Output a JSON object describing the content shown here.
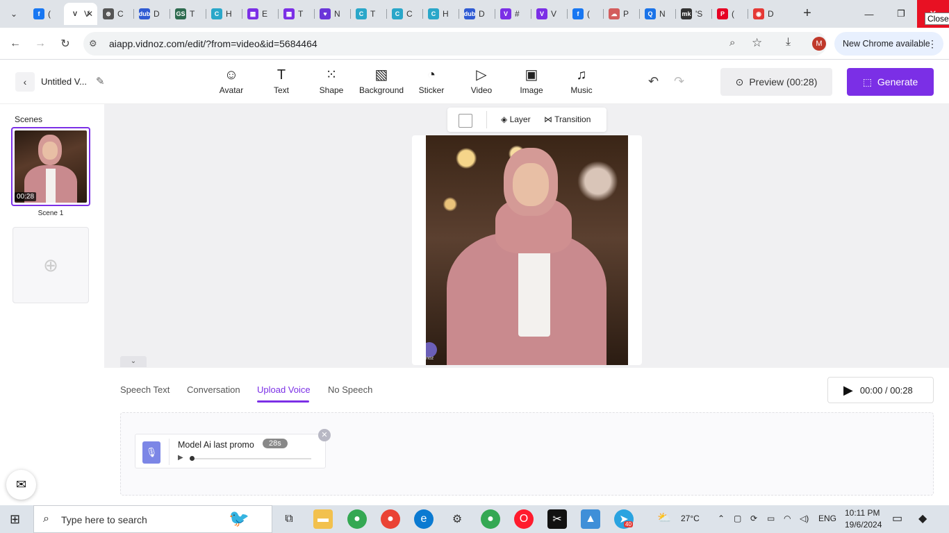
{
  "browser": {
    "tabs": [
      {
        "fav": "f",
        "color": "#1877f2",
        "title": "("
      },
      {
        "fav": "V",
        "color": "#ffffff",
        "title": "V",
        "active": true
      },
      {
        "fav": "⊛",
        "color": "#555555",
        "title": "C"
      },
      {
        "fav": "dub",
        "color": "#2f5bd3",
        "title": "D"
      },
      {
        "fav": "GS",
        "color": "#2d6b4f",
        "title": "T"
      },
      {
        "fav": "C",
        "color": "#2aa7c9",
        "title": "H"
      },
      {
        "fav": "▦",
        "color": "#7b2fe6",
        "title": "E"
      },
      {
        "fav": "▦",
        "color": "#7b2fe6",
        "title": "T"
      },
      {
        "fav": "♥",
        "color": "#6a36d9",
        "title": "N"
      },
      {
        "fav": "C",
        "color": "#2aa7c9",
        "title": "T"
      },
      {
        "fav": "C",
        "color": "#2aa7c9",
        "title": "C"
      },
      {
        "fav": "C",
        "color": "#2aa7c9",
        "title": "H"
      },
      {
        "fav": "dub",
        "color": "#2f5bd3",
        "title": "D"
      },
      {
        "fav": "V",
        "color": "#7b2fe6",
        "title": "#"
      },
      {
        "fav": "V",
        "color": "#7b2fe6",
        "title": "V"
      },
      {
        "fav": "f",
        "color": "#1877f2",
        "title": "("
      },
      {
        "fav": "☁",
        "color": "#d35d5d",
        "title": "P"
      },
      {
        "fav": "Q",
        "color": "#1a73e8",
        "title": "N"
      },
      {
        "fav": "mk",
        "color": "#333333",
        "title": "'S"
      },
      {
        "fav": "P",
        "color": "#e60023",
        "title": "("
      },
      {
        "fav": "◉",
        "color": "#e53935",
        "title": "D"
      }
    ],
    "active_tab_close": "✕",
    "new_tab": "+",
    "window_min": "—",
    "window_max": "❐",
    "window_close": "✕",
    "close_tooltip": "Close",
    "url": "aiapp.vidnoz.com/edit/?from=video&id=5684464",
    "profile_initial": "M",
    "update_label": "New Chrome available"
  },
  "app": {
    "project_title": "Untitled V...",
    "tools": [
      {
        "label": "Avatar",
        "icon": "☺"
      },
      {
        "label": "Text",
        "icon": "T"
      },
      {
        "label": "Shape",
        "icon": "⁙"
      },
      {
        "label": "Background",
        "icon": "▧"
      },
      {
        "label": "Sticker",
        "icon": "◔"
      },
      {
        "label": "Video",
        "icon": "▷"
      },
      {
        "label": "Image",
        "icon": "▣"
      },
      {
        "label": "Music",
        "icon": "♫"
      }
    ],
    "preview_label": "Preview (00:28)",
    "generate_label": "Generate",
    "accent": "#7b2fe6"
  },
  "sidebar": {
    "title": "Scenes",
    "scenes": [
      {
        "name": "Scene 1",
        "duration": "00:28"
      }
    ],
    "add_scene": "+"
  },
  "canvas": {
    "layer_label": "Layer",
    "transition_label": "Transition",
    "watermark": "noz"
  },
  "voice_panel": {
    "tabs": [
      "Speech Text",
      "Conversation",
      "Upload Voice",
      "No Speech"
    ],
    "active_tab": "Upload Voice",
    "playback": "00:00 / 00:28",
    "audio": {
      "name": "Model Ai last promo",
      "duration": "28s",
      "progress": 0
    }
  },
  "taskbar": {
    "search_placeholder": "Type here to search",
    "weather": "27°C",
    "language": "ENG",
    "time": "10:11 PM",
    "date": "19/6/2024",
    "telegram_badge": "40"
  }
}
